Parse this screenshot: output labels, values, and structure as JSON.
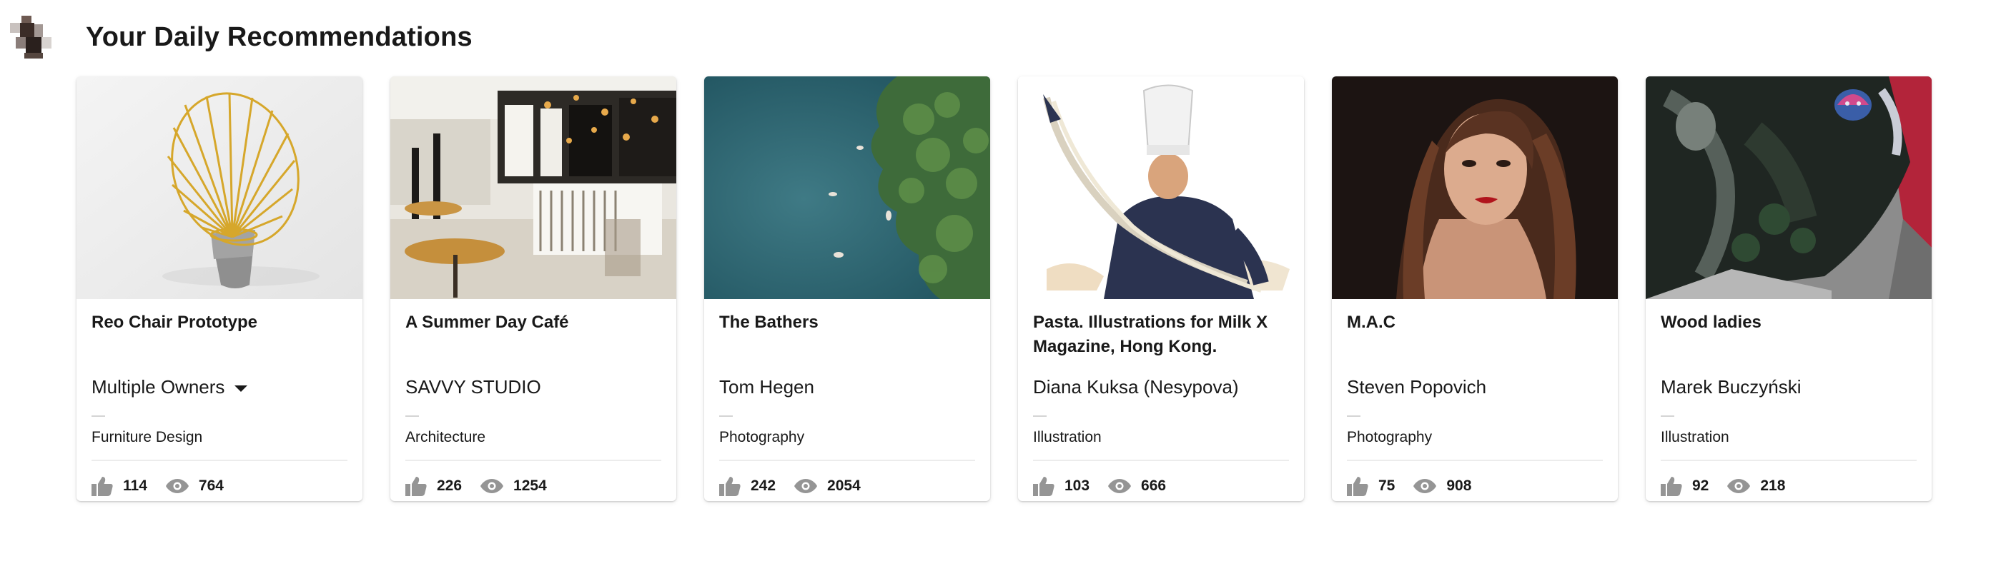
{
  "page": {
    "title": "Your Daily Recommendations"
  },
  "colors": {
    "text": "#191919",
    "muted_icon": "#959595",
    "divider": "#ececec"
  },
  "cards": [
    {
      "title": "Reo Chair Prototype",
      "owner": "Multiple Owners",
      "owner_has_dropdown": true,
      "field": "Furniture Design",
      "appreciations": "114",
      "views": "764",
      "image": "gold-wire-chair"
    },
    {
      "title": "A Summer Day Café",
      "owner": "SAVVY STUDIO",
      "owner_has_dropdown": false,
      "field": "Architecture",
      "appreciations": "226",
      "views": "1254",
      "image": "cafe-interior"
    },
    {
      "title": "The Bathers",
      "owner": "Tom Hegen",
      "owner_has_dropdown": false,
      "field": "Photography",
      "appreciations": "242",
      "views": "2054",
      "image": "aerial-swimmers"
    },
    {
      "title": "Pasta. Illustrations for Milk X Magazine, Hong Kong.",
      "owner": "Diana Kuksa (Nesypova)",
      "owner_has_dropdown": false,
      "field": "Illustration",
      "appreciations": "103",
      "views": "666",
      "image": "chef-illustration"
    },
    {
      "title": "M.A.C",
      "owner": "Steven Popovich",
      "owner_has_dropdown": false,
      "field": "Photography",
      "appreciations": "75",
      "views": "908",
      "image": "beauty-portrait"
    },
    {
      "title": "Wood ladies",
      "owner": "Marek Buczyński",
      "owner_has_dropdown": false,
      "field": "Illustration",
      "appreciations": "92",
      "views": "218",
      "image": "dark-art-print"
    }
  ]
}
